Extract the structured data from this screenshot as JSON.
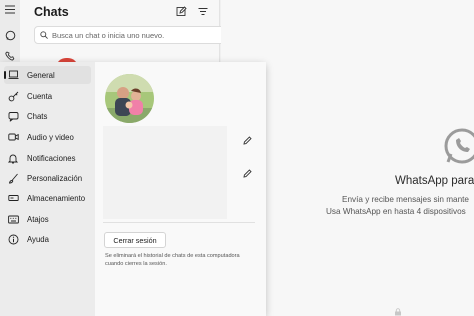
{
  "chat_list": {
    "title": "Chats",
    "search_placeholder": "Busca un chat o inicia uno nuevo."
  },
  "settings": {
    "nav": [
      {
        "label": "General",
        "icon": "laptop-icon",
        "active": true
      },
      {
        "label": "Cuenta",
        "icon": "key-icon",
        "active": false
      },
      {
        "label": "Chats",
        "icon": "chat-bubble-icon",
        "active": false
      },
      {
        "label": "Audio y video",
        "icon": "video-icon",
        "active": false
      },
      {
        "label": "Notificaciones",
        "icon": "bell-icon",
        "active": false
      },
      {
        "label": "Personalización",
        "icon": "brush-icon",
        "active": false
      },
      {
        "label": "Almacenamiento",
        "icon": "storage-icon",
        "active": false
      },
      {
        "label": "Atajos",
        "icon": "keyboard-icon",
        "active": false
      },
      {
        "label": "Ayuda",
        "icon": "info-icon",
        "active": false
      }
    ],
    "logout_label": "Cerrar sesión",
    "logout_note": "Se eliminará el historial de chats de esta computadora cuando cierres la sesión."
  },
  "welcome": {
    "title": "WhatsApp para",
    "line1": "Envía y recibe mensajes sin mante",
    "line2": "Usa WhatsApp en hasta 4 dispositivos"
  },
  "colors": {
    "accent_red": "#d9443a",
    "panel_bg": "#f3f3f3",
    "nav_active": "#e1e1e1"
  }
}
